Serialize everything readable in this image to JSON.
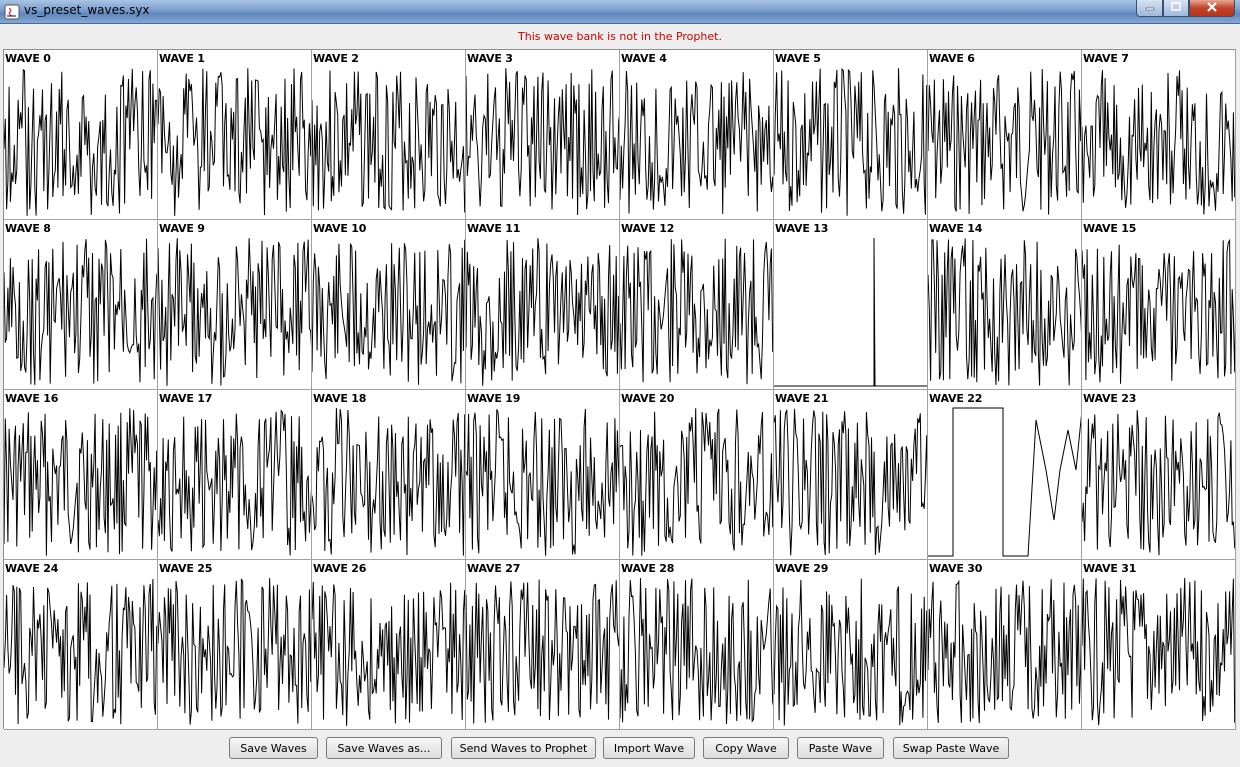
{
  "window": {
    "title": "vs_preset_waves.syx"
  },
  "status": {
    "message": "This wave bank is not in the Prophet."
  },
  "waves": [
    {
      "label": "WAVE 0"
    },
    {
      "label": "WAVE 1"
    },
    {
      "label": "WAVE 2"
    },
    {
      "label": "WAVE 3"
    },
    {
      "label": "WAVE 4"
    },
    {
      "label": "WAVE 5"
    },
    {
      "label": "WAVE 6"
    },
    {
      "label": "WAVE 7"
    },
    {
      "label": "WAVE 8"
    },
    {
      "label": "WAVE 9"
    },
    {
      "label": "WAVE 10"
    },
    {
      "label": "WAVE 11"
    },
    {
      "label": "WAVE 12"
    },
    {
      "label": "WAVE 13"
    },
    {
      "label": "WAVE 14"
    },
    {
      "label": "WAVE 15"
    },
    {
      "label": "WAVE 16"
    },
    {
      "label": "WAVE 17"
    },
    {
      "label": "WAVE 18"
    },
    {
      "label": "WAVE 19"
    },
    {
      "label": "WAVE 20"
    },
    {
      "label": "WAVE 21"
    },
    {
      "label": "WAVE 22"
    },
    {
      "label": "WAVE 23"
    },
    {
      "label": "WAVE 24"
    },
    {
      "label": "WAVE 25"
    },
    {
      "label": "WAVE 26"
    },
    {
      "label": "WAVE 27"
    },
    {
      "label": "WAVE 28"
    },
    {
      "label": "WAVE 29"
    },
    {
      "label": "WAVE 30"
    },
    {
      "label": "WAVE 31"
    }
  ],
  "buttons": {
    "save_waves": "Save Waves",
    "save_waves_as": "Save Waves as...",
    "send_waves": "Send Waves to Prophet",
    "import_wave": "Import Wave",
    "copy_wave": "Copy Wave",
    "paste_wave": "Paste Wave",
    "swap_paste_wave": "Swap Paste Wave"
  }
}
